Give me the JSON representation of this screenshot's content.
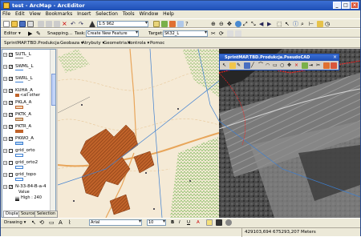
{
  "window": {
    "title": "test - ArcMap - ArcEditor",
    "min": "_",
    "max": "□",
    "close": "×"
  },
  "menu": [
    "File",
    "Edit",
    "View",
    "Bookmarks",
    "Insert",
    "Selection",
    "Tools",
    "Window",
    "Help"
  ],
  "standard_toolbar": {
    "scale": "1:5 962"
  },
  "editor_toolbar": {
    "editor_label": "Editor ▾",
    "snapping_label": "Snapping...",
    "task_label": "Task:",
    "task_value": "Create New Feature",
    "target_label": "Target:",
    "target_value": "SK32_L"
  },
  "sprint_toolbar": {
    "title": "SprintMAP.TBD.Produkcja",
    "menus": [
      "Geobaza ▾",
      "Atrybuty ▾",
      "Geometria ▾",
      "Kontrola ▾",
      "Pomoc"
    ]
  },
  "toc": {
    "layers": [
      {
        "name": "SUTL_L",
        "checked": true
      },
      {
        "name": "SWML_L",
        "checked": true
      },
      {
        "name": "SWRL_L",
        "checked": true
      },
      {
        "name": "KUHA_A",
        "checked": true,
        "legend": "<all other"
      },
      {
        "name": "PKLA_A",
        "checked": true
      },
      {
        "name": "PKTK_A",
        "checked": true
      },
      {
        "name": "PKTR_A",
        "checked": true
      },
      {
        "name": "PKWO_A",
        "checked": true
      },
      {
        "name": "grid_orto",
        "checked": false
      },
      {
        "name": "grid_orto2",
        "checked": false
      },
      {
        "name": "grid_topo",
        "checked": false
      },
      {
        "name": "N-33-84-B-a-4",
        "checked": true,
        "legend": "Value",
        "legend2": "High : 240"
      }
    ],
    "tabs": [
      "Display",
      "Source",
      "Selection"
    ]
  },
  "float_toolbar": {
    "title": "SprintMAP.TBD.Produkcja.PseudoCAD"
  },
  "drawing_toolbar": {
    "drawing_label": "Drawing ▾",
    "font": "Arial",
    "size": "10",
    "bold": "B",
    "italic": "I",
    "underline": "U",
    "font_color": "A"
  },
  "status": {
    "coords": "429103,694  675293,207 Meters"
  },
  "colors": {
    "accent": "#1f4fb5",
    "parcel": "#c0632a",
    "water": "#3d7fd1",
    "road": "#e8a55a",
    "forest": "#6cb34a"
  }
}
